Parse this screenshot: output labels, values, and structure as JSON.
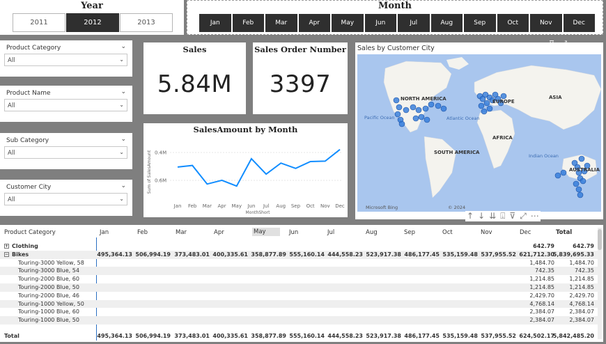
{
  "year_slicer": {
    "title": "Year",
    "options": [
      "2011",
      "2012",
      "2013"
    ],
    "selected": "2012"
  },
  "month_slicer": {
    "title": "Month",
    "options": [
      "Jan",
      "Feb",
      "Mar",
      "Apr",
      "May",
      "Jun",
      "Jul",
      "Aug",
      "Sep",
      "Oct",
      "Nov",
      "Dec"
    ]
  },
  "filters": [
    {
      "label": "Product Category",
      "value": "All"
    },
    {
      "label": "Product Name",
      "value": "All"
    },
    {
      "label": "Sub Category",
      "value": "All"
    },
    {
      "label": "Customer City",
      "value": "All"
    }
  ],
  "cards": {
    "sales": {
      "title": "Sales",
      "value": "5.84M"
    },
    "orders": {
      "title": "Sales Order Number",
      "value": "3397"
    }
  },
  "line_chart": {
    "title": "SalesAmount by Month",
    "ylabel": "Sum of SalesAmount",
    "xlabel": "MonthShort",
    "ytick_labels": [
      "0.6M",
      "0.4M"
    ],
    "color": "#118dff"
  },
  "chart_data": {
    "type": "line",
    "title": "SalesAmount by Month",
    "xlabel": "MonthShort",
    "ylabel": "Sum of SalesAmount",
    "categories": [
      "Jan",
      "Feb",
      "Mar",
      "Apr",
      "May",
      "Jun",
      "Jul",
      "Aug",
      "Sep",
      "Oct",
      "Nov",
      "Dec"
    ],
    "values": [
      495364.13,
      506994.19,
      373483.01,
      400335.61,
      358877.89,
      555160.14,
      444558.23,
      523917.38,
      486177.45,
      535159.48,
      537955.52,
      621712.3
    ],
    "yticks": [
      400000,
      600000
    ],
    "ylim": [
      300000,
      660000
    ]
  },
  "map": {
    "title": "Sales by Customer City",
    "labels": [
      "NORTH AMERICA",
      "EUROPE",
      "ASIA",
      "AFRICA",
      "SOUTH AMERICA",
      "AUSTRALIA"
    ],
    "oceans": [
      "Pacific Ocean",
      "Atlantic Ocean",
      "Indian Ocean"
    ],
    "attribution": "Microsoft Bing",
    "copyright": "© 2024",
    "bubble_color": "#2f79d9"
  },
  "table": {
    "headers": [
      "Product Category",
      "Jan",
      "Feb",
      "Mar",
      "Apr",
      "May",
      "Jun",
      "Jul",
      "Aug",
      "Sep",
      "Oct",
      "Nov",
      "Dec",
      "Total"
    ],
    "rows": [
      {
        "label": "Clothing",
        "expander": "+",
        "bold": true,
        "cells": [
          "",
          "",
          "",
          "",
          "",
          "",
          "",
          "",
          "",
          "",
          "",
          "642.79",
          "642.79"
        ]
      },
      {
        "label": "Bikes",
        "expander": "−",
        "bold": true,
        "cells": [
          "495,364.13",
          "506,994.19",
          "373,483.01",
          "400,335.61",
          "358,877.89",
          "555,160.14",
          "444,558.23",
          "523,917.38",
          "486,177.45",
          "535,159.48",
          "537,955.52",
          "621,712.30",
          "5,839,695.33"
        ]
      },
      {
        "label": "Touring-3000 Yellow, 58",
        "cells": [
          "",
          "",
          "",
          "",
          "",
          "",
          "",
          "",
          "",
          "",
          "",
          "1,484.70",
          "1,484.70"
        ]
      },
      {
        "label": "Touring-3000 Blue, 54",
        "cells": [
          "",
          "",
          "",
          "",
          "",
          "",
          "",
          "",
          "",
          "",
          "",
          "742.35",
          "742.35"
        ]
      },
      {
        "label": "Touring-2000 Blue, 60",
        "cells": [
          "",
          "",
          "",
          "",
          "",
          "",
          "",
          "",
          "",
          "",
          "",
          "1,214.85",
          "1,214.85"
        ]
      },
      {
        "label": "Touring-2000 Blue, 50",
        "cells": [
          "",
          "",
          "",
          "",
          "",
          "",
          "",
          "",
          "",
          "",
          "",
          "1,214.85",
          "1,214.85"
        ]
      },
      {
        "label": "Touring-2000 Blue, 46",
        "cells": [
          "",
          "",
          "",
          "",
          "",
          "",
          "",
          "",
          "",
          "",
          "",
          "2,429.70",
          "2,429.70"
        ]
      },
      {
        "label": "Touring-1000 Yellow, 50",
        "cells": [
          "",
          "",
          "",
          "",
          "",
          "",
          "",
          "",
          "",
          "",
          "",
          "4,768.14",
          "4,768.14"
        ]
      },
      {
        "label": "Touring-1000 Blue, 60",
        "cells": [
          "",
          "",
          "",
          "",
          "",
          "",
          "",
          "",
          "",
          "",
          "",
          "2,384.07",
          "2,384.07"
        ]
      },
      {
        "label": "Touring-1000 Blue, 50",
        "cells": [
          "",
          "",
          "",
          "",
          "",
          "",
          "",
          "",
          "",
          "",
          "",
          "2,384.07",
          "2,384.07"
        ]
      }
    ],
    "total": {
      "label": "Total",
      "cells": [
        "495,364.13",
        "506,994.19",
        "373,483.01",
        "400,335.61",
        "358,877.89",
        "555,160.14",
        "444,558.23",
        "523,917.38",
        "486,177.45",
        "535,159.48",
        "537,955.52",
        "624,502.17",
        "5,842,485.20"
      ]
    }
  }
}
